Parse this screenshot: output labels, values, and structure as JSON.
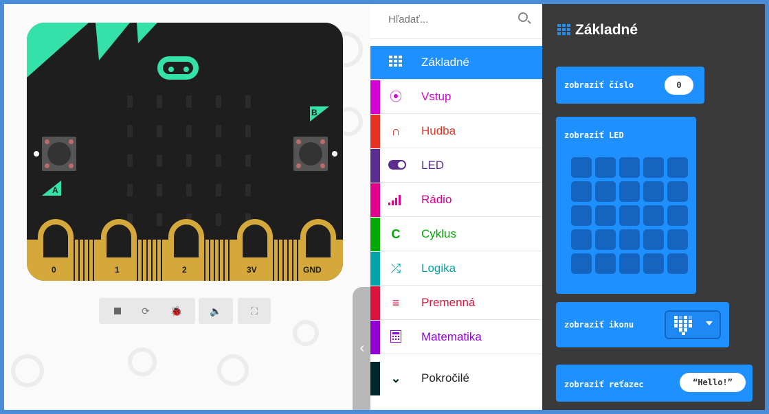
{
  "board": {
    "button_a": "A",
    "button_b": "B",
    "pins": [
      "0",
      "1",
      "2",
      "3V",
      "GND"
    ]
  },
  "toolbox": {
    "search_placeholder": "Hľadať...",
    "categories": [
      {
        "label": "Základné",
        "icon": "grid-icon",
        "color": "#1e90ff"
      },
      {
        "label": "Vstup",
        "icon": "target-icon",
        "color": "#d400d4"
      },
      {
        "label": "Hudba",
        "icon": "headphones-icon",
        "color": "#e63022"
      },
      {
        "label": "LED",
        "icon": "toggle-icon",
        "color": "#5c2d91"
      },
      {
        "label": "Rádio",
        "icon": "signal-icon",
        "color": "#e3008c"
      },
      {
        "label": "Cyklus",
        "icon": "refresh-icon",
        "color": "#00aa00"
      },
      {
        "label": "Logika",
        "icon": "shuffle-icon",
        "color": "#00a4a6"
      },
      {
        "label": "Premenná",
        "icon": "lines-icon",
        "color": "#dc143c"
      },
      {
        "label": "Matematika",
        "icon": "calculator-icon",
        "color": "#9400d3"
      },
      {
        "label": "Pokročilé",
        "icon": "chevron-down-icon",
        "color": "#00272b"
      }
    ]
  },
  "workspace": {
    "title": "Základné",
    "blocks": {
      "show_number": {
        "label": "zobraziť číslo",
        "value": "0"
      },
      "show_leds": {
        "label": "zobraziť LED"
      },
      "show_icon": {
        "label": "zobraziť ikonu"
      },
      "show_string": {
        "label": "zobraziť reťazec",
        "value": "Hello!"
      }
    }
  }
}
